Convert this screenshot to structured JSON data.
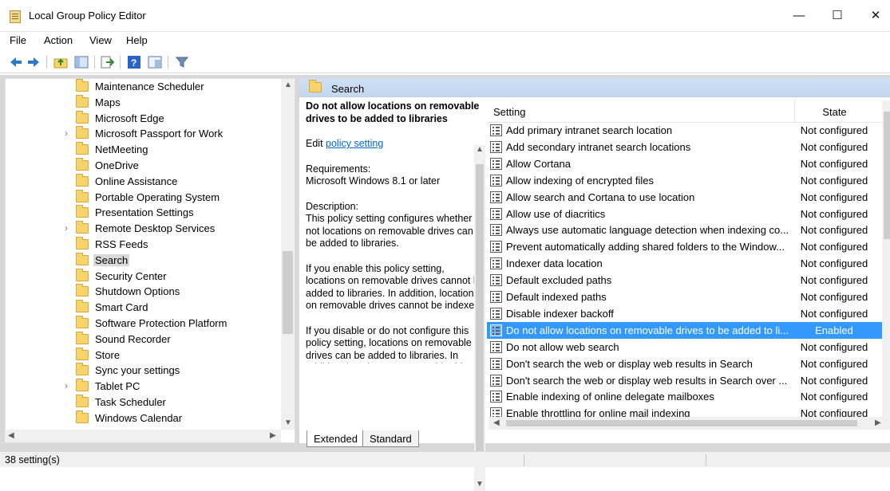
{
  "window": {
    "title": "Local Group Policy Editor",
    "minimize": "—",
    "maximize": "☐",
    "close": "✕"
  },
  "menu": [
    "File",
    "Action",
    "View",
    "Help"
  ],
  "tree": {
    "items": [
      {
        "label": "Maintenance Scheduler",
        "expandable": false
      },
      {
        "label": "Maps",
        "expandable": false
      },
      {
        "label": "Microsoft Edge",
        "expandable": false
      },
      {
        "label": "Microsoft Passport for Work",
        "expandable": true
      },
      {
        "label": "NetMeeting",
        "expandable": false
      },
      {
        "label": "OneDrive",
        "expandable": false
      },
      {
        "label": "Online Assistance",
        "expandable": false
      },
      {
        "label": "Portable Operating System",
        "expandable": false
      },
      {
        "label": "Presentation Settings",
        "expandable": false
      },
      {
        "label": "Remote Desktop Services",
        "expandable": true
      },
      {
        "label": "RSS Feeds",
        "expandable": false
      },
      {
        "label": "Search",
        "expandable": false,
        "selected": true
      },
      {
        "label": "Security Center",
        "expandable": false
      },
      {
        "label": "Shutdown Options",
        "expandable": false
      },
      {
        "label": "Smart Card",
        "expandable": false
      },
      {
        "label": "Software Protection Platform",
        "expandable": false
      },
      {
        "label": "Sound Recorder",
        "expandable": false
      },
      {
        "label": "Store",
        "expandable": false
      },
      {
        "label": "Sync your settings",
        "expandable": false
      },
      {
        "label": "Tablet PC",
        "expandable": true
      },
      {
        "label": "Task Scheduler",
        "expandable": false
      },
      {
        "label": "Windows Calendar",
        "expandable": false
      }
    ]
  },
  "right_pane": {
    "folder_title": "Search",
    "description": {
      "heading": "Do not allow locations on removable drives to be added to libraries",
      "edit_prefix": "Edit ",
      "edit_link": "policy setting",
      "requirements_label": "Requirements:",
      "requirements": "Microsoft Windows 8.1 or later",
      "description_label": "Description:",
      "p1": "This policy setting configures whether or not locations on removable drives can be added to libraries.",
      "p2": "If you enable this policy setting, locations on removable drives cannot be added to libraries.  In addition, locations on removable drives cannot be indexed.",
      "p3": "If you disable or do not configure this policy setting, locations on removable drives can be added to libraries.  In addition, locations on removable drives can be indexed."
    },
    "columns": {
      "setting": "Setting",
      "state": "State"
    },
    "settings": [
      {
        "name": "Add primary intranet search location",
        "state": "Not configured"
      },
      {
        "name": "Add secondary intranet search locations",
        "state": "Not configured"
      },
      {
        "name": "Allow Cortana",
        "state": "Not configured"
      },
      {
        "name": "Allow indexing of encrypted files",
        "state": "Not configured"
      },
      {
        "name": "Allow search and Cortana to use location",
        "state": "Not configured"
      },
      {
        "name": "Allow use of diacritics",
        "state": "Not configured"
      },
      {
        "name": "Always use automatic language detection when indexing co...",
        "state": "Not configured"
      },
      {
        "name": "Prevent automatically adding shared folders to the Window...",
        "state": "Not configured"
      },
      {
        "name": "Indexer data location",
        "state": "Not configured"
      },
      {
        "name": "Default excluded paths",
        "state": "Not configured"
      },
      {
        "name": "Default indexed paths",
        "state": "Not configured"
      },
      {
        "name": "Disable indexer backoff",
        "state": "Not configured"
      },
      {
        "name": "Do not allow locations on removable drives to be added to li...",
        "state": "Enabled",
        "selected": true
      },
      {
        "name": "Do not allow web search",
        "state": "Not configured"
      },
      {
        "name": "Don't search the web or display web results in Search",
        "state": "Not configured"
      },
      {
        "name": "Don't search the web or display web results in Search over ...",
        "state": "Not configured"
      },
      {
        "name": "Enable indexing of online delegate mailboxes",
        "state": "Not configured"
      },
      {
        "name": "Enable throttling for online mail indexing",
        "state": "Not configured"
      }
    ],
    "tabs": [
      "Extended",
      "Standard"
    ]
  },
  "status": {
    "text": "38 setting(s)"
  }
}
